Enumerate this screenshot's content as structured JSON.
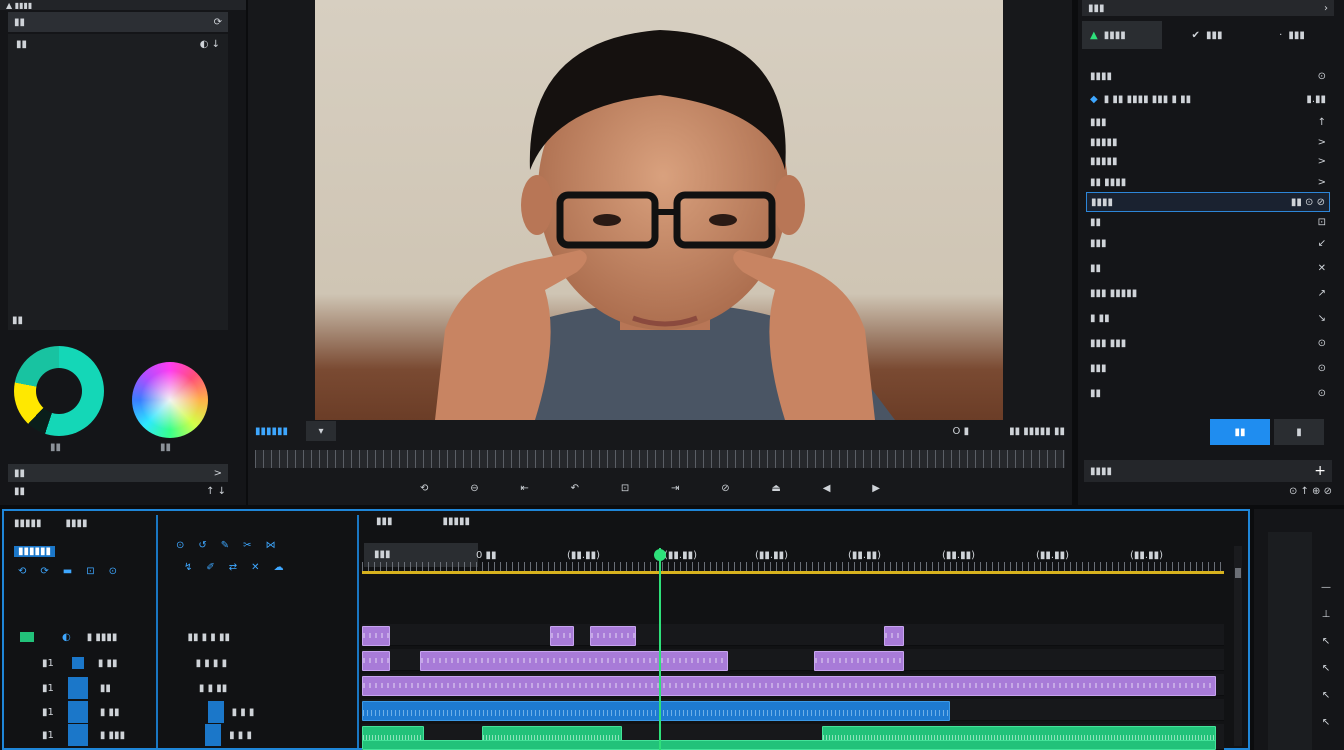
{
  "left_panel": {
    "title": "▲ ▮▮▮▮",
    "header_label": "▮▮",
    "header_icon": "⟳",
    "list_label": "▮▮",
    "list_icons": "◐ ↓",
    "list_footer_label": "▮▮",
    "wheel_left_label": "▮▮",
    "wheel_right_label": "▮▮",
    "sub_label": "▮▮",
    "sub_chevron": ">",
    "bottom_label": "▮▮",
    "bottom_icons": "↑ ↓"
  },
  "viewer": {
    "title": "▮▮▮▮▮▮",
    "timecode": "▮▮ ▮▮▮▮▮ ▮▮",
    "zoom": "O ▮",
    "transport": [
      "⟲",
      "⊖",
      "⇤",
      "↶",
      "⊡",
      "⇥",
      "⊘",
      "⏏",
      "◀",
      "▶"
    ]
  },
  "inspector": {
    "title": "▮▮▮",
    "tabs": [
      {
        "label": "▮▮▮▮",
        "icon": "triangle-icon"
      },
      {
        "label": "▮▮▮",
        "icon": "check-icon"
      },
      {
        "label": "▮▮▮",
        "icon": "dot-icon"
      }
    ],
    "items": [
      {
        "label": "▮▮▮▮",
        "value": "⊙"
      },
      {
        "label": "▮ ▮▮ ▮▮▮▮ ▮▮▮ ▮ ▮▮",
        "value": "▮.▮▮"
      },
      {
        "label": "▮▮▮",
        "value": "↑"
      },
      {
        "label": "▮▮▮▮▮",
        "value": ">"
      },
      {
        "label": "▮▮▮▮▮",
        "value": ">"
      },
      {
        "label": "▮▮ ▮▮▮▮",
        "value": ">"
      },
      {
        "label": "▮▮▮▮",
        "value": "▮▮ ⊙ ⊘"
      },
      {
        "label": "▮▮",
        "value": "⊡"
      },
      {
        "label": "▮▮▮",
        "value": "↙"
      },
      {
        "label": "▮▮",
        "value": "✕"
      },
      {
        "label": "▮▮▮ ▮▮▮▮▮",
        "value": "↗"
      },
      {
        "label": "▮ ▮▮",
        "value": "↘"
      },
      {
        "label": "▮▮▮ ▮▮▮",
        "value": "⊙"
      },
      {
        "label": "▮▮▮",
        "value": "⊙"
      },
      {
        "label": "▮▮",
        "value": "⊙"
      }
    ],
    "button_primary": "▮▮",
    "button_secondary": "▮",
    "footer_label": "▮▮▮▮",
    "footer_add": "+",
    "footer_icons": "⊙ ↑ ⊕ ⊘"
  },
  "timeline": {
    "title_a": "▮▮▮▮▮",
    "title_b": "▮▮▮▮",
    "col_a": "▮▮▮",
    "col_b": "▮▮▮▮▮",
    "chip": "▮▮▮▮▮▮",
    "ruler_first": "▮▮▮",
    "ruler_labels": [
      "0 ▮▮",
      "(▮▮.▮▮)",
      "(▮▮.▮▮)",
      "(▮▮.▮▮)",
      "(▮▮.▮▮)",
      "(▮▮.▮▮)",
      "(▮▮.▮▮)",
      "(▮▮.▮▮)"
    ],
    "tracks": [
      {
        "name": "▮ ▮▮▮▮",
        "num": "▮",
        "tools": "▮▮ ▮ ▮ ▮▮"
      },
      {
        "name": "▮ ▮▮",
        "num": "▮1",
        "tools": "▮ ▮ ▮ ▮"
      },
      {
        "name": "▮▮",
        "num": "▮1",
        "tools": "▮ ▮ ▮▮"
      },
      {
        "name": "▮ ▮▮",
        "num": "▮1",
        "tools": "▮ ▮ ▮"
      },
      {
        "name": "▮ ▮▮▮",
        "num": "▮1",
        "tools": "▮ ▮ ▮"
      }
    ]
  },
  "colors": {
    "accent": "#1f8df0",
    "timeline_border": "#1f86d8",
    "playhead": "#2ee07a",
    "video_clip": "#a87bd8",
    "audio_clip": "#1e7ad0",
    "music_clip": "#22c27a",
    "ruler_line": "#d7b21e"
  }
}
